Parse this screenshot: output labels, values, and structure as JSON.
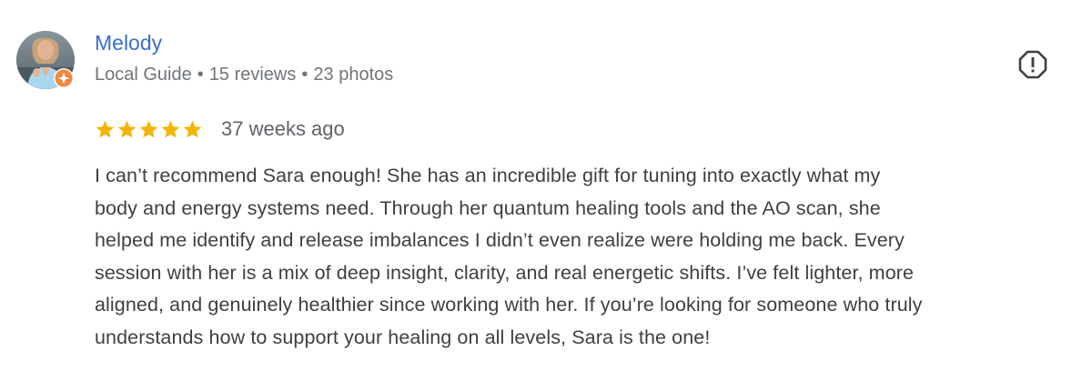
{
  "review": {
    "author": {
      "name": "Melody",
      "badge": "Local Guide",
      "separator": "•",
      "reviews": "15 reviews",
      "photos": "23 photos",
      "avatar_icon": "profile-photo",
      "badge_icon": "local-guide-star-icon"
    },
    "rating": {
      "stars": 5,
      "max_stars": 5,
      "star_color": "#f4b400",
      "date": "37 weeks ago"
    },
    "report_icon": "report-icon",
    "text_lines": [
      "I can’t recommend Sara enough! She has an incredible gift for tuning into exactly what my",
      "body and energy systems need. Through her quantum healing tools and the AO scan, she",
      "helped me identify and release imbalances I didn’t even realize were holding me back. Every",
      "session with her is a mix of deep insight, clarity, and real energetic shifts. I’ve felt lighter, more",
      "aligned, and genuinely healthier since working with her. If you’re looking for someone who truly",
      "understands how to support your healing on all levels, Sara is the one!"
    ]
  },
  "colors": {
    "author_link": "#3a6fcf",
    "meta_text": "#70757a",
    "body_text": "#3c4043",
    "badge_orange": "#f0883e"
  }
}
